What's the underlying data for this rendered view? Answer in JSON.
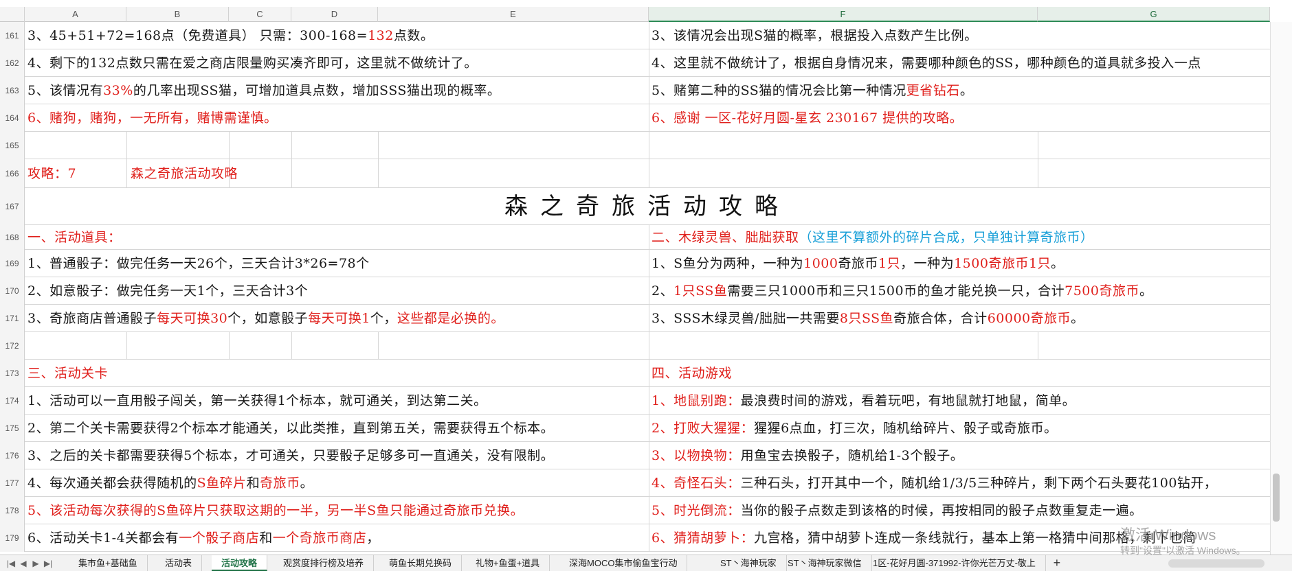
{
  "columns": [
    "A",
    "B",
    "C",
    "D",
    "E",
    "F",
    "G"
  ],
  "rows": [
    {
      "n": "161",
      "left": [
        {
          "t": "3、45+51+72=168点（免费道具） 只需：300-168="
        },
        {
          "t": "132",
          "c": "red"
        },
        {
          "t": "点数。"
        }
      ],
      "right": [
        {
          "t": "3、该情况会出现S猫的概率，根据投入点数产生比例。"
        }
      ]
    },
    {
      "n": "162",
      "left": [
        {
          "t": "4、剩下的132点数只需在爱之商店限量购买凑齐即可，这里就不做统计了。"
        }
      ],
      "right": [
        {
          "t": "4、这里就不做统计了，根据自身情况来，需要哪种颜色的SS，哪种颜色的道具就多投入一点"
        }
      ]
    },
    {
      "n": "163",
      "left": [
        {
          "t": "5、该情况有"
        },
        {
          "t": "33%",
          "c": "red"
        },
        {
          "t": "的几率出现SS猫，可增加道具点数，增加SSS猫出现的概率。"
        }
      ],
      "right": [
        {
          "t": "5、赌第二种的SS猫的情况会比第一种情况"
        },
        {
          "t": "更省钻石",
          "c": "red"
        },
        {
          "t": "。"
        }
      ]
    },
    {
      "n": "164",
      "left": [
        {
          "t": "6、赌狗，赌狗，一无所有，赌博需谨慎。",
          "c": "red"
        }
      ],
      "right": [
        {
          "t": "6、感谢 一区-花好月圆-星玄 230167 提供的攻略。",
          "c": "red"
        }
      ]
    },
    {
      "n": "165",
      "left": [],
      "right": []
    },
    {
      "n": "166",
      "left": [
        {
          "t": "攻略：7",
          "c": "red"
        }
      ],
      "leftB": [
        {
          "t": "森之奇旅活动攻略",
          "c": "red"
        }
      ],
      "right": []
    },
    {
      "n": "167",
      "title": "森之奇旅活动攻略"
    },
    {
      "n": "168",
      "left": [
        {
          "t": "一、活动道具：",
          "c": "red"
        }
      ],
      "right": [
        {
          "t": "二、木绿灵兽、朏朏获取",
          "c": "red"
        },
        {
          "t": "（这里不算额外的碎片合成，只单独计算奇旅币）",
          "c": "blue"
        }
      ]
    },
    {
      "n": "169",
      "left": [
        {
          "t": "1、普通骰子：做完任务一天26个，三天合计3*26=78个"
        }
      ],
      "right": [
        {
          "t": "1、S鱼分为两种，一种为"
        },
        {
          "t": "1000",
          "c": "red"
        },
        {
          "t": "奇旅币"
        },
        {
          "t": "1只",
          "c": "red"
        },
        {
          "t": "，一种为"
        },
        {
          "t": "1500奇旅币1只",
          "c": "red"
        },
        {
          "t": "。"
        }
      ]
    },
    {
      "n": "170",
      "left": [
        {
          "t": "2、如意骰子：做完任务一天1个，三天合计3个"
        }
      ],
      "right": [
        {
          "t": "2、"
        },
        {
          "t": "1只SS鱼",
          "c": "red"
        },
        {
          "t": "需要三只1000币和三只1500币的鱼才能兑换一只，合计"
        },
        {
          "t": "7500奇旅币",
          "c": "red"
        },
        {
          "t": "。"
        }
      ]
    },
    {
      "n": "171",
      "left": [
        {
          "t": "3、奇旅商店普通骰子"
        },
        {
          "t": "每天可换30",
          "c": "red"
        },
        {
          "t": "个，如意骰子"
        },
        {
          "t": "每天可换1",
          "c": "red"
        },
        {
          "t": "个，"
        },
        {
          "t": "这些都是必换的。",
          "c": "red"
        }
      ],
      "right": [
        {
          "t": "3、SSS木绿灵兽/朏朏一共需要"
        },
        {
          "t": "8只SS鱼",
          "c": "red"
        },
        {
          "t": "奇旅合体，合计"
        },
        {
          "t": "60000奇旅币",
          "c": "red"
        },
        {
          "t": "。"
        }
      ]
    },
    {
      "n": "172",
      "left": [],
      "right": []
    },
    {
      "n": "173",
      "left": [
        {
          "t": "三、活动关卡",
          "c": "red"
        }
      ],
      "right": [
        {
          "t": "四、活动游戏",
          "c": "red"
        }
      ]
    },
    {
      "n": "174",
      "left": [
        {
          "t": "1、活动可以一直用骰子闯关，第一关获得1个标本，就可通关，到达第二关。"
        }
      ],
      "right": [
        {
          "t": "1、地鼠别跑：",
          "c": "red"
        },
        {
          "t": "最浪费时间的游戏，看着玩吧，有地鼠就打地鼠，简单。"
        }
      ]
    },
    {
      "n": "175",
      "left": [
        {
          "t": "2、第二个关卡需要获得2个标本才能通关，以此类推，直到第五关，需要获得五个标本。"
        }
      ],
      "right": [
        {
          "t": "2、打败大猩猩：",
          "c": "red"
        },
        {
          "t": "猩猩6点血，打三次，随机给碎片、骰子或奇旅币。"
        }
      ]
    },
    {
      "n": "176",
      "left": [
        {
          "t": "3、之后的关卡都需要获得5个标本，才可通关，只要骰子足够多可一直通关，没有限制。"
        }
      ],
      "right": [
        {
          "t": "3、以物换物：",
          "c": "red"
        },
        {
          "t": "用鱼宝去换骰子，随机给1-3个骰子。"
        }
      ]
    },
    {
      "n": "177",
      "left": [
        {
          "t": "4、每次通关都会获得随机的"
        },
        {
          "t": "S鱼碎片",
          "c": "red"
        },
        {
          "t": "和"
        },
        {
          "t": "奇旅币",
          "c": "red"
        },
        {
          "t": "。"
        }
      ],
      "right": [
        {
          "t": "4、奇怪石头：",
          "c": "red"
        },
        {
          "t": "三种石头，打开其中一个，随机给1/3/5三种碎片，剩下两个石头要花100钻开，"
        }
      ]
    },
    {
      "n": "178",
      "left": [
        {
          "t": "5、该活动每次获得的S鱼碎片只获取这期的一半，另一半S鱼只能通过奇旅币兑换。",
          "c": "red"
        }
      ],
      "right": [
        {
          "t": "5、时光倒流：",
          "c": "red"
        },
        {
          "t": "当你的骰子点数走到该格的时候，再按相同的骰子点数重复走一遍。"
        }
      ]
    },
    {
      "n": "179",
      "left": [
        {
          "t": "6、活动关卡1-4关都会有"
        },
        {
          "t": "一个骰子商店",
          "c": "red"
        },
        {
          "t": "和"
        },
        {
          "t": "一个奇旅币商店",
          "c": "red"
        },
        {
          "t": "，"
        }
      ],
      "right": [
        {
          "t": "6、猜猜胡萝卜：",
          "c": "red"
        },
        {
          "t": "九宫格，猜中胡萝卜连成一条线就行，基本上第一格猜中间那格，剩下也简"
        }
      ]
    }
  ],
  "tabs": [
    "集市鱼+基础鱼",
    "活动表",
    "活动攻略",
    "观赏度排行榜及培养",
    "萌鱼长期兑换码",
    "礼物+鱼蛋+道具",
    "深海MOCO集市偷鱼宝行动",
    "ST丶海神玩家",
    "ST丶海神玩家微信",
    "1区-花好月圆-371992-许你光芒万丈-敬上"
  ],
  "active_tab": "活动攻略",
  "nav_buttons": [
    "|◀",
    "◀",
    "▶",
    "▶|"
  ],
  "add_tab": "+",
  "watermark": {
    "line1": "激活 Windows",
    "line2": "转到\"设置\"以激活 Windows。"
  }
}
